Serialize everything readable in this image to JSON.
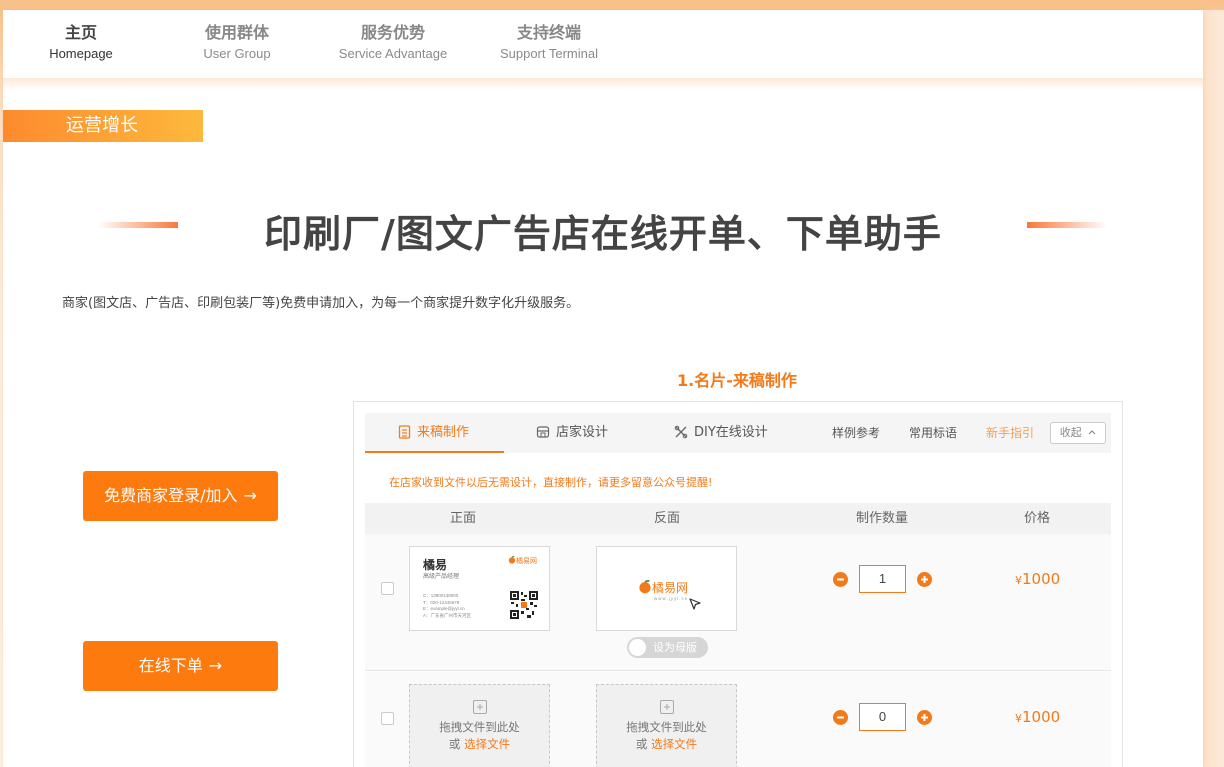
{
  "nav": {
    "items": [
      {
        "zh": "主页",
        "en": "Homepage"
      },
      {
        "zh": "使用群体",
        "en": "User Group"
      },
      {
        "zh": "服务优势",
        "en": "Service Advantage"
      },
      {
        "zh": "支持终端",
        "en": "Support Terminal"
      }
    ],
    "active_index": 0
  },
  "section_tag": "运营增长",
  "main_title": "印刷厂/图文广告店在线开单、下单助手",
  "subtitle": "商家(图文店、广告店、印刷包装厂等)免费申请加入，为每一个商家提升数字化升级服务。",
  "step_title": "1.名片-来稿制作",
  "cta": {
    "login_label": "免费商家登录/加入",
    "order_label": "在线下单",
    "arrow": "→"
  },
  "colors": {
    "accent": "#f27a1a",
    "cta": "#fd7a0f"
  },
  "panel": {
    "tabs": [
      {
        "label": "来稿制作",
        "icon": "document-icon"
      },
      {
        "label": "店家设计",
        "icon": "store-icon"
      },
      {
        "label": "DIY在线设计",
        "icon": "tools-icon"
      }
    ],
    "links": [
      "样例参考",
      "常用标语",
      "新手指引"
    ],
    "collapse_label": "收起",
    "notice": "在店家收到文件以后无需设计，直接制作，请更多留意公众号提醒!",
    "columns": [
      "正面",
      "反面",
      "制作数量",
      "价格"
    ],
    "rows": [
      {
        "front": {
          "name": "橘易",
          "role": "高级产品经理",
          "logo": "橘易网",
          "lines": [
            "C：13800138000",
            "T：020-12345678",
            "E：example@jyyl.cn",
            "A：广东省广州市天河区"
          ]
        },
        "back": {
          "brand": "橘易网",
          "url": "www.jyyl.cn"
        },
        "toggle_label": "设为母版",
        "quantity": "1",
        "currency": "¥",
        "price": "1000"
      },
      {
        "dropzone": {
          "line1": "拖拽文件到此处",
          "or": "或",
          "pick": "选择文件"
        },
        "quantity": "0",
        "currency": "¥",
        "price": "1000"
      }
    ]
  }
}
